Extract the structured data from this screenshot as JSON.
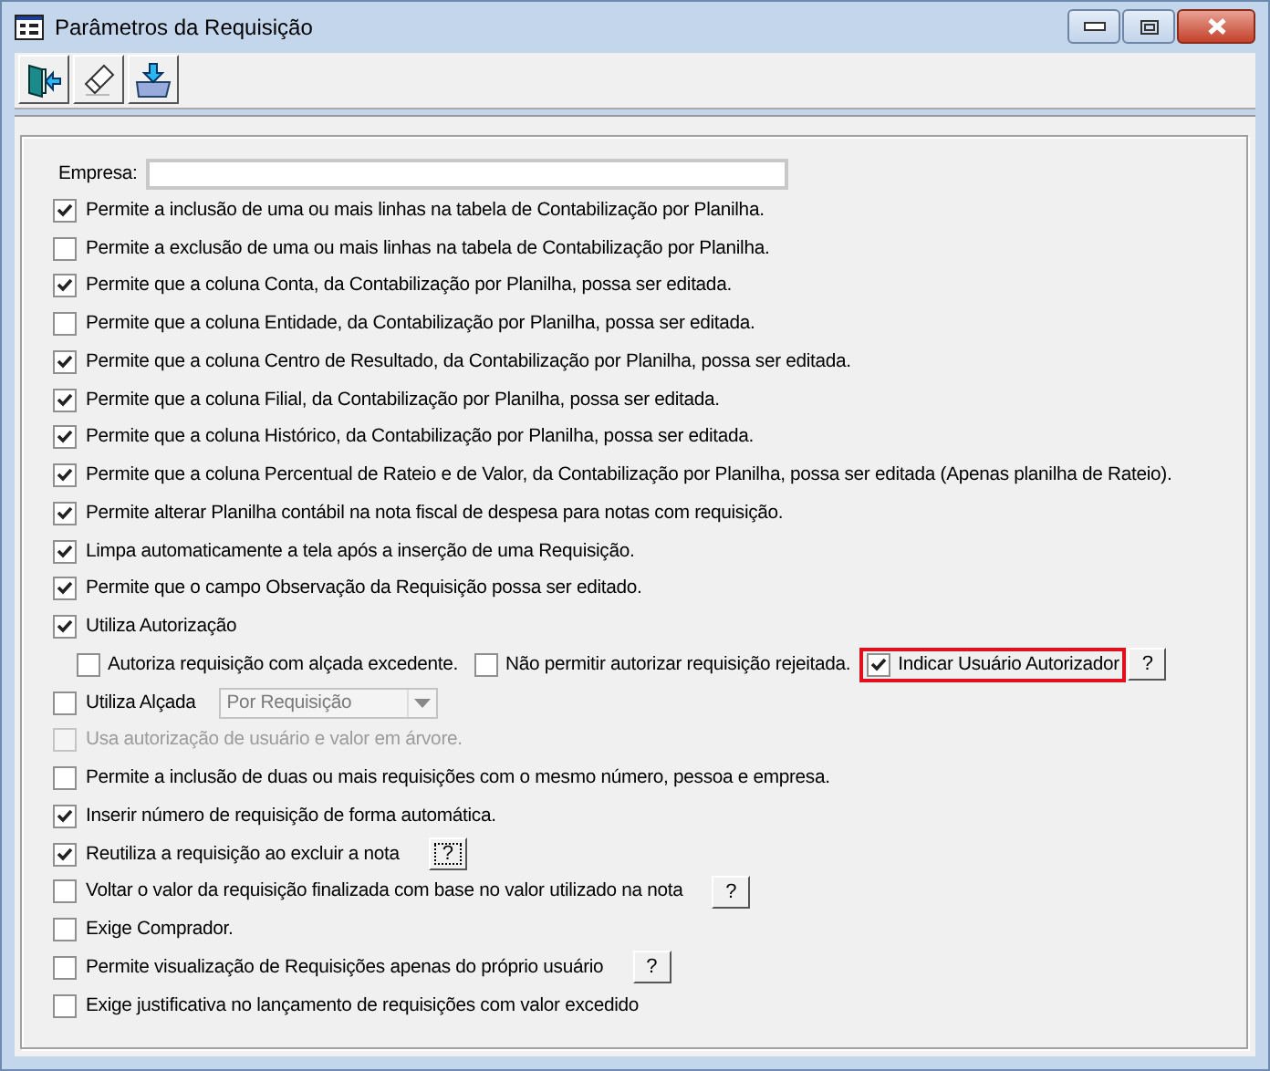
{
  "window": {
    "title": "Parâmetros da Requisição"
  },
  "toolbar": [
    {
      "kind": "exit"
    },
    {
      "kind": "eraser"
    },
    {
      "kind": "save"
    }
  ],
  "empresa": {
    "label": "Empresa:"
  },
  "options": [
    {
      "kind": "check",
      "label": "Permite a inclusão de uma ou mais linhas na tabela de Contabilização por Planilha.",
      "checked": true,
      "disabled": false
    },
    {
      "kind": "check",
      "label": "Permite a exclusão de uma ou mais linhas na tabela de Contabilização por Planilha.",
      "checked": false,
      "disabled": false
    },
    {
      "kind": "check",
      "label": "Permite que a coluna Conta, da Contabilização por Planilha, possa ser editada.",
      "checked": true,
      "disabled": false
    },
    {
      "kind": "check",
      "label": "Permite que a coluna Entidade, da Contabilização por Planilha, possa ser editada.",
      "checked": false,
      "disabled": false
    },
    {
      "kind": "check",
      "label": "Permite que a coluna Centro de Resultado, da Contabilização por Planilha, possa ser editada.",
      "checked": true,
      "disabled": false
    },
    {
      "kind": "check",
      "label": "Permite que a coluna Filial, da Contabilização por Planilha, possa ser editada.",
      "checked": true,
      "disabled": false
    },
    {
      "kind": "check",
      "label": "Permite que a coluna Histórico, da Contabilização por Planilha, possa ser editada.",
      "checked": true,
      "disabled": false
    },
    {
      "kind": "check",
      "label": "Permite que a coluna Percentual de Rateio e de Valor, da Contabilização por Planilha, possa ser editada (Apenas planilha de Rateio).",
      "checked": true,
      "disabled": false
    },
    {
      "kind": "check",
      "label": "Permite alterar Planilha contábil na nota fiscal de despesa para notas com requisição.",
      "checked": true,
      "disabled": false
    },
    {
      "kind": "check",
      "label": "Limpa automaticamente a tela após a inserção de uma Requisição.",
      "checked": true,
      "disabled": false
    },
    {
      "kind": "check",
      "label": "Permite que o campo Observação da Requisição possa ser editado.",
      "checked": true,
      "disabled": false
    },
    {
      "kind": "check",
      "label": "Utiliza Autorização",
      "checked": true,
      "disabled": false
    },
    {
      "kind": "subrow",
      "children": [
        {
          "label": "Autoriza requisição com alçada excedente.",
          "checked": false,
          "highlighted": false
        },
        {
          "label": "Não permitir autorizar requisição rejeitada.",
          "checked": false,
          "highlighted": false
        },
        {
          "label": "Indicar Usuário Autorizador",
          "checked": true,
          "highlighted": true
        }
      ],
      "help": {
        "label": "?",
        "focused": false
      }
    },
    {
      "kind": "select",
      "label": "Utiliza Alçada",
      "checked": false,
      "disabled": false,
      "select": {
        "value": "Por Requisição",
        "disabled": true
      }
    },
    {
      "kind": "check",
      "label": "Usa autorização de usuário e valor em árvore.",
      "checked": false,
      "disabled": true
    },
    {
      "kind": "check",
      "label": "Permite a inclusão de duas ou mais requisições com o mesmo número, pessoa e empresa.",
      "checked": false,
      "disabled": false
    },
    {
      "kind": "check",
      "label": "Inserir número de requisição de forma automática.",
      "checked": true,
      "disabled": false
    },
    {
      "kind": "check",
      "label": "Reutiliza a requisição ao excluir a nota",
      "checked": true,
      "disabled": false,
      "help": {
        "label": "?",
        "focused": true
      }
    },
    {
      "kind": "check",
      "label": "Voltar o valor da requisição finalizada com base no valor utilizado na nota",
      "checked": false,
      "disabled": false,
      "help": {
        "label": "?",
        "focused": false
      }
    },
    {
      "kind": "check",
      "label": "Exige Comprador.",
      "checked": false,
      "disabled": false
    },
    {
      "kind": "check",
      "label": "Permite visualização de Requisições apenas do próprio usuário",
      "checked": false,
      "disabled": false,
      "help": {
        "label": "?",
        "focused": false
      }
    },
    {
      "kind": "check",
      "label": "Exige justificativa no lançamento de requisições com valor excedido",
      "checked": false,
      "disabled": false
    }
  ]
}
